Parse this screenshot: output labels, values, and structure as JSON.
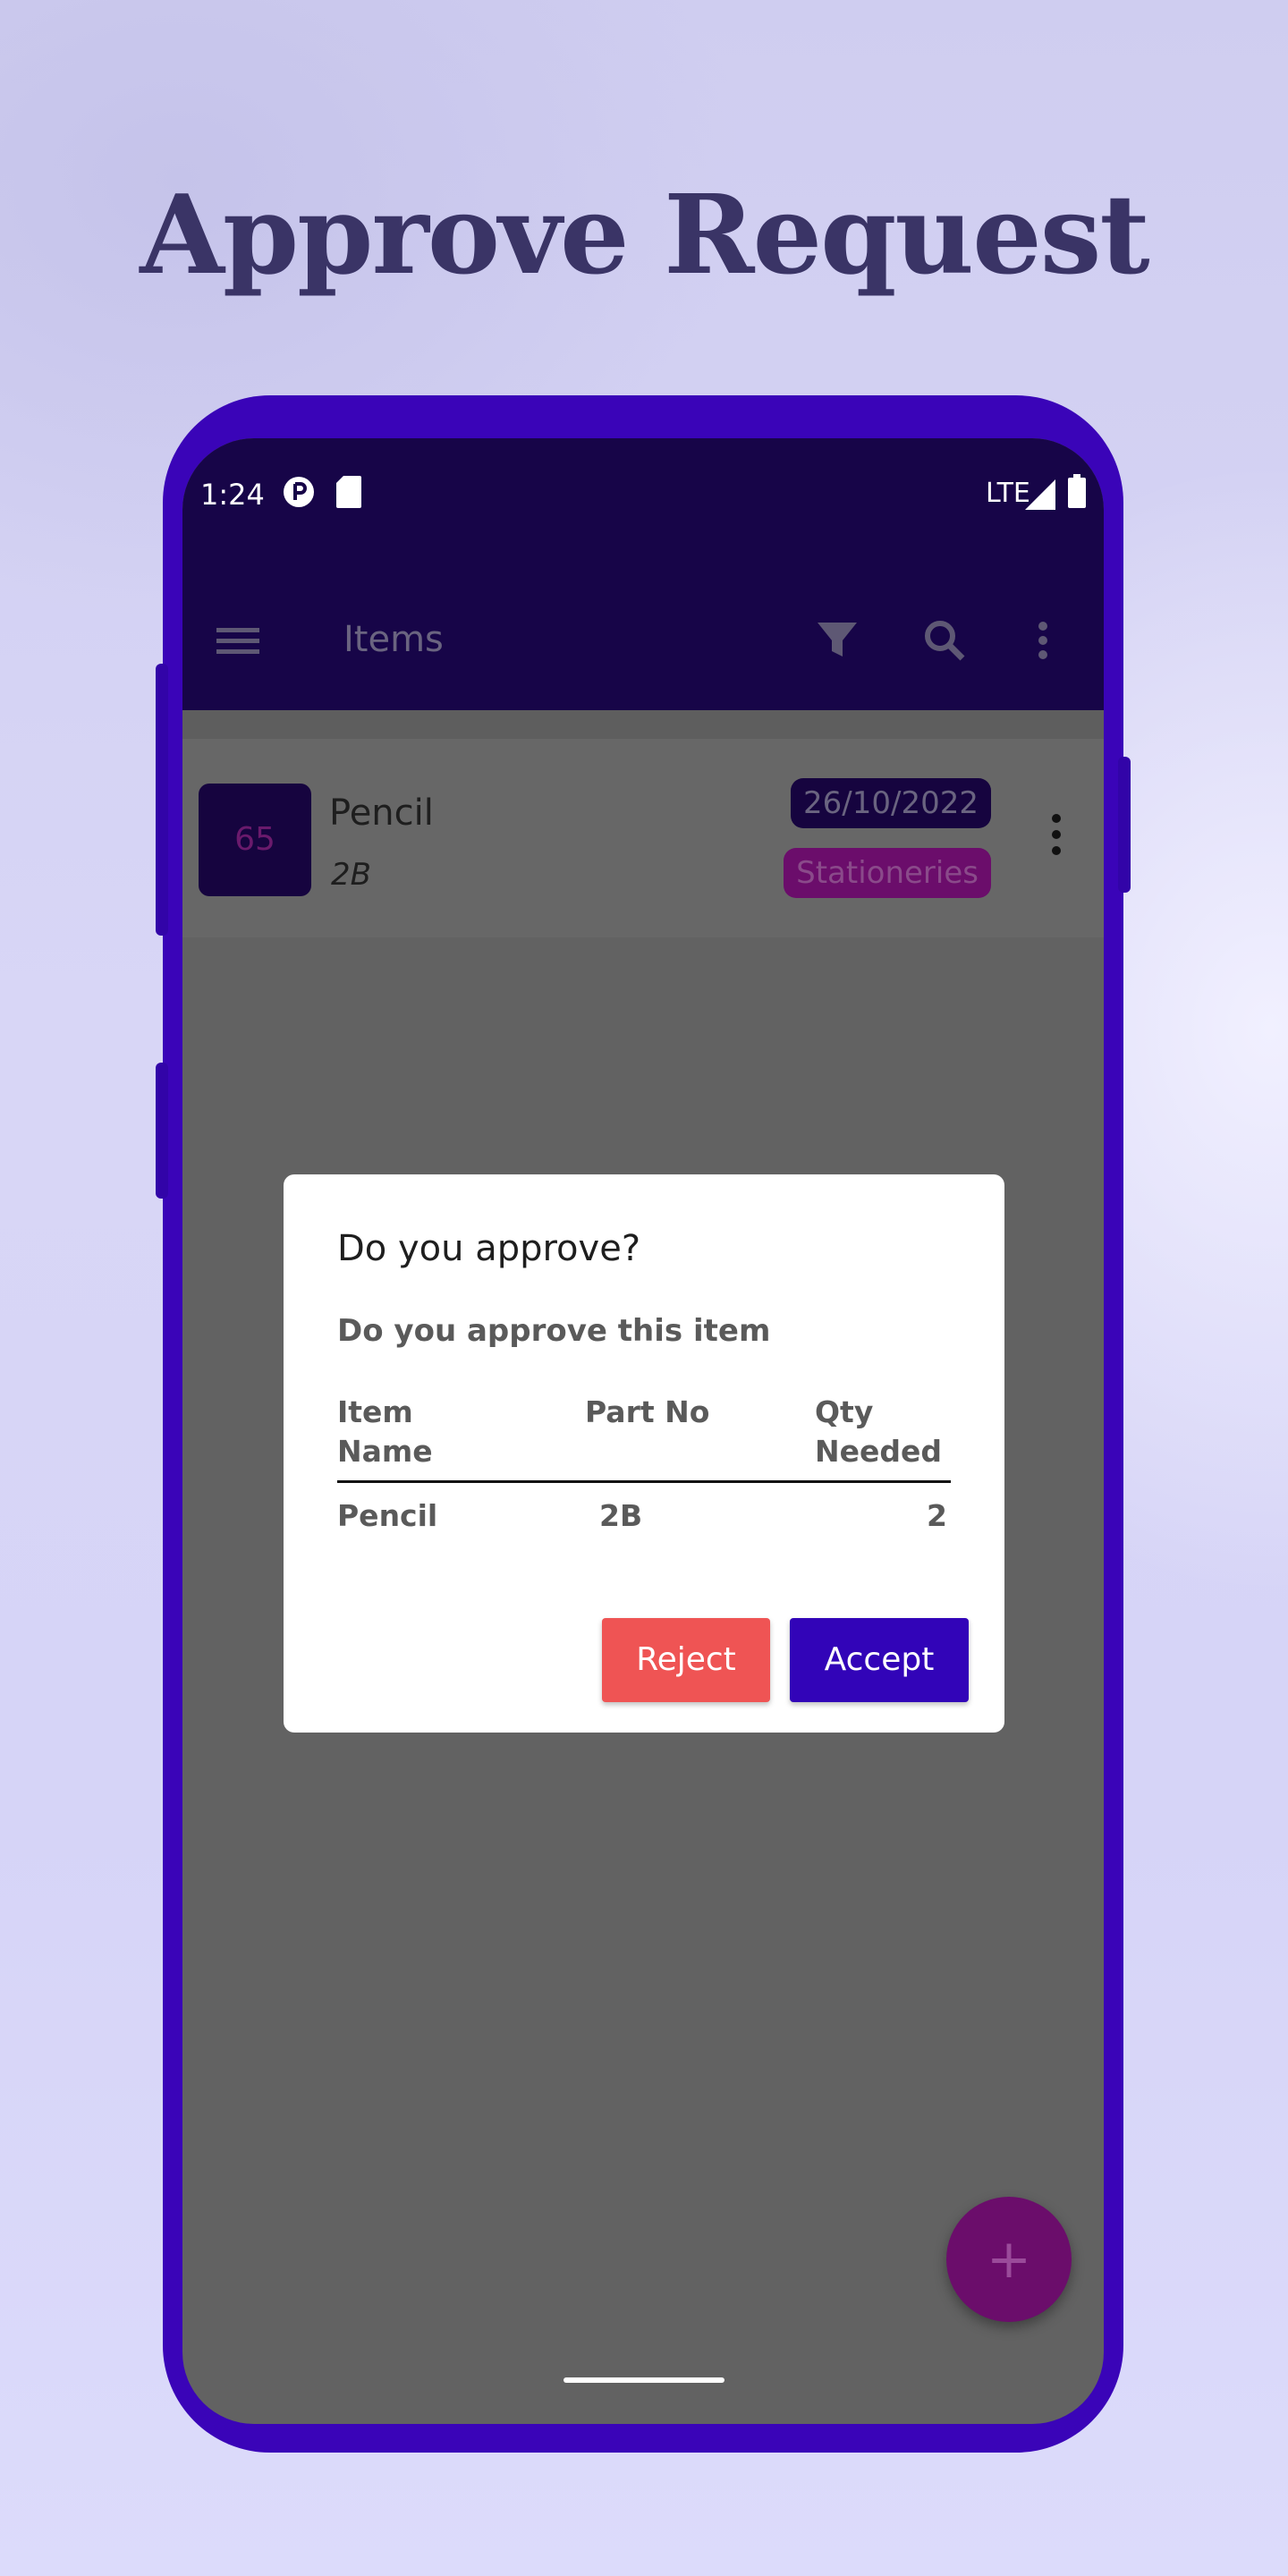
{
  "headline": "Approve Request",
  "status_bar": {
    "time": "1:24",
    "network": "LTE"
  },
  "toolbar": {
    "title": "Items"
  },
  "list": {
    "items": [
      {
        "avatar_text": "65",
        "name": "Pencil",
        "part": "2B",
        "date": "26/10/2022",
        "category": "Stationeries"
      }
    ]
  },
  "dialog": {
    "title": "Do you approve?",
    "message": "Do you approve this item",
    "columns": [
      "Item Name",
      "Part No",
      "Qty Needed"
    ],
    "row": {
      "item_name": "Pencil",
      "part_no": "2B",
      "qty_needed": "2"
    },
    "reject_label": "Reject",
    "accept_label": "Accept"
  },
  "fab": {
    "label": "+"
  },
  "colors": {
    "primary_dark": "#170548",
    "device_frame": "#3a04b8",
    "accent": "#6b0d6b",
    "reject": "#ef5454",
    "accept": "#3204b8"
  },
  "icons": [
    "menu-icon",
    "filter-icon",
    "search-icon",
    "more-vert-icon",
    "signal-icon",
    "battery-icon",
    "sd-card-icon",
    "app-notification-icon",
    "plus-icon"
  ]
}
